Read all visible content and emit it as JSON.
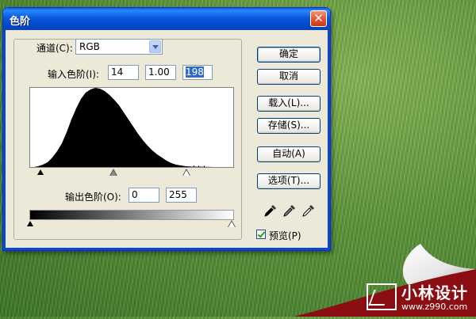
{
  "dialog": {
    "title": "色阶",
    "close_label": "✕",
    "channel": {
      "label": "通道(C):",
      "value": "RGB"
    },
    "input_levels": {
      "label": "输入色阶(I):",
      "shadows": "14",
      "gamma": "1.00",
      "highlights": "198"
    },
    "output_levels": {
      "label": "输出色阶(O):",
      "min": "0",
      "max": "255"
    },
    "buttons": {
      "ok": "确定",
      "cancel": "取消",
      "load": "载入(L)...",
      "save": "存储(S)...",
      "auto": "自动(A)",
      "options": "选项(T)..."
    },
    "eyedroppers": [
      "black-eyedropper-icon",
      "gray-eyedropper-icon",
      "white-eyedropper-icon"
    ],
    "preview": {
      "label": "预览(P)",
      "checked": true
    }
  },
  "watermark": {
    "name": "小林设计",
    "url": "www.z990.com"
  },
  "colors": {
    "titlebar": "#0a58dc",
    "dialog_bg": "#ece9d8",
    "close": "#e4532c",
    "curl_red": "#8b0e12"
  }
}
